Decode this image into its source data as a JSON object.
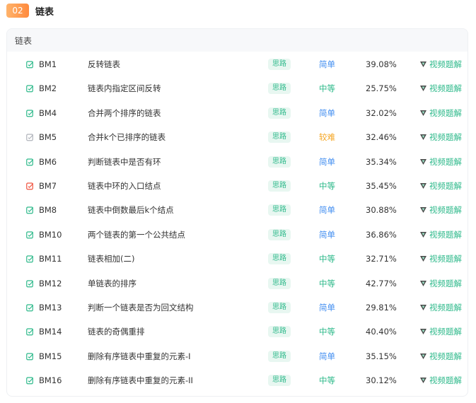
{
  "section": {
    "number": "02",
    "title": "链表"
  },
  "card": {
    "header": "链表"
  },
  "colors": {
    "status_done": "#2db98a",
    "status_none": "#b0b4bb",
    "status_error": "#f0533f",
    "tag_bg": "#e8f7f1",
    "tag_text": "#2db98a",
    "easy": "#3f8cf0",
    "medium": "#2db98a",
    "hard": "#f5a623"
  },
  "rows": [
    {
      "status": "done",
      "id": "BM1",
      "name": "反转链表",
      "tag": "思路",
      "difficulty": "简单",
      "level": "easy",
      "rate": "39.08%",
      "video": "视频题解"
    },
    {
      "status": "done",
      "id": "BM2",
      "name": "链表内指定区间反转",
      "tag": "思路",
      "difficulty": "中等",
      "level": "mid",
      "rate": "25.75%",
      "video": "视频题解"
    },
    {
      "status": "done",
      "id": "BM4",
      "name": "合并两个排序的链表",
      "tag": "思路",
      "difficulty": "简单",
      "level": "easy",
      "rate": "32.02%",
      "video": "视频题解"
    },
    {
      "status": "none",
      "id": "BM5",
      "name": "合并k个已排序的链表",
      "tag": "思路",
      "difficulty": "较难",
      "level": "hard",
      "rate": "32.46%",
      "video": "视频题解"
    },
    {
      "status": "done",
      "id": "BM6",
      "name": "判断链表中是否有环",
      "tag": "思路",
      "difficulty": "简单",
      "level": "easy",
      "rate": "35.34%",
      "video": "视频题解"
    },
    {
      "status": "error",
      "id": "BM7",
      "name": "链表中环的入口结点",
      "tag": "思路",
      "difficulty": "中等",
      "level": "mid",
      "rate": "35.45%",
      "video": "视频题解"
    },
    {
      "status": "done",
      "id": "BM8",
      "name": "链表中倒数最后k个结点",
      "tag": "思路",
      "difficulty": "简单",
      "level": "easy",
      "rate": "30.88%",
      "video": "视频题解"
    },
    {
      "status": "done",
      "id": "BM10",
      "name": "两个链表的第一个公共结点",
      "tag": "思路",
      "difficulty": "简单",
      "level": "easy",
      "rate": "36.86%",
      "video": "视频题解"
    },
    {
      "status": "done",
      "id": "BM11",
      "name": "链表相加(二)",
      "tag": "思路",
      "difficulty": "中等",
      "level": "mid",
      "rate": "32.71%",
      "video": "视频题解"
    },
    {
      "status": "done",
      "id": "BM12",
      "name": "单链表的排序",
      "tag": "思路",
      "difficulty": "中等",
      "level": "mid",
      "rate": "42.77%",
      "video": "视频题解"
    },
    {
      "status": "done",
      "id": "BM13",
      "name": "判断一个链表是否为回文结构",
      "tag": "思路",
      "difficulty": "简单",
      "level": "easy",
      "rate": "29.81%",
      "video": "视频题解"
    },
    {
      "status": "done",
      "id": "BM14",
      "name": "链表的奇偶重排",
      "tag": "思路",
      "difficulty": "中等",
      "level": "mid",
      "rate": "40.40%",
      "video": "视频题解"
    },
    {
      "status": "done",
      "id": "BM15",
      "name": "删除有序链表中重复的元素-I",
      "tag": "思路",
      "difficulty": "简单",
      "level": "easy",
      "rate": "35.15%",
      "video": "视频题解"
    },
    {
      "status": "done",
      "id": "BM16",
      "name": "删除有序链表中重复的元素-II",
      "tag": "思路",
      "difficulty": "中等",
      "level": "mid",
      "rate": "30.12%",
      "video": "视频题解"
    }
  ]
}
